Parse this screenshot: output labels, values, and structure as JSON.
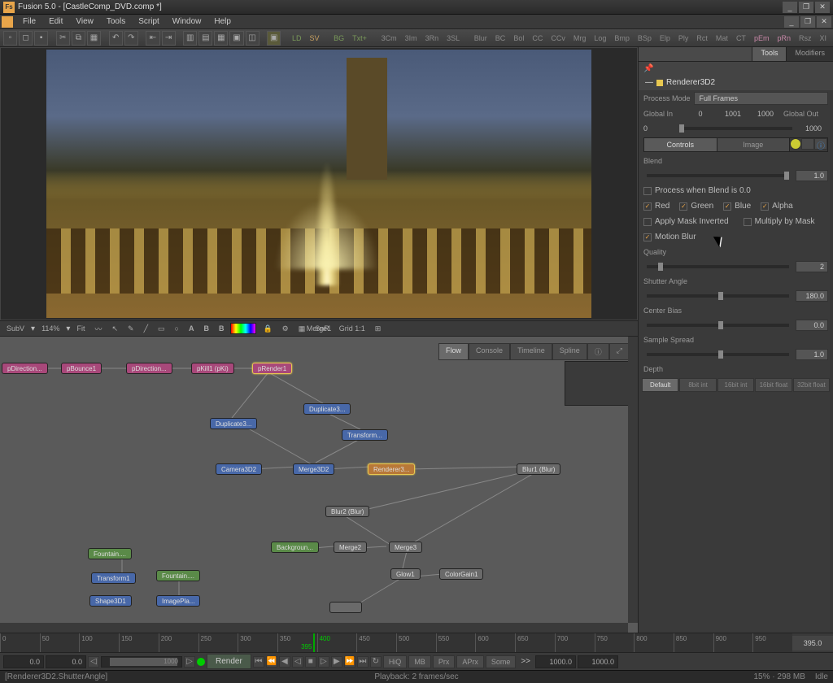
{
  "title": "Fusion 5.0 - [CastleComp_DVD.comp *]",
  "menu": [
    "File",
    "Edit",
    "View",
    "Tools",
    "Script",
    "Window",
    "Help"
  ],
  "toolbar_text": [
    "LD",
    "SV",
    "BG",
    "Txt+",
    "3Cm",
    "3Im",
    "3Rn",
    "3SL",
    "Blur",
    "BC",
    "Bol",
    "CC",
    "CCv",
    "Mrg",
    "Log",
    "Bmp",
    "BSp",
    "Elp",
    "Ply",
    "Rct",
    "Mat",
    "CT",
    "pEm",
    "pRn",
    "Rsz",
    "XI"
  ],
  "viewer_toolbar": {
    "subv": "SubV",
    "zoom": "114%",
    "fit": "Fit",
    "abb": [
      "A",
      "B",
      "B"
    ],
    "snr": "SnR",
    "grid": "Grid 1:1",
    "current": "Merge1"
  },
  "flow_tabs": [
    "Flow",
    "Console",
    "Timeline",
    "Spline"
  ],
  "nodes": {
    "pDirection1": "pDirection...",
    "pBounce1": "pBounce1",
    "pDirection2": "pDirection...",
    "pKill1": "pKill1  (pKi)",
    "pRender1": "pRender1",
    "Duplicate3a": "Duplicate3...",
    "Duplicate3b": "Duplicate3...",
    "Transform1": "Transform...",
    "Camera3D2": "Camera3D2",
    "Merge3D2": "Merge3D2",
    "Renderer3": "Renderer3...",
    "Blur1": "Blur1  (Blur)",
    "Blur2": "Blur2  (Blur)",
    "Background": "Backgroun...",
    "Merge2": "Merge2",
    "Merge3": "Merge3",
    "Fountain1": "Fountain....",
    "Fountain2": "Fountain....",
    "TransformB": "Transform1",
    "Shape3D1": "Shape3D1",
    "ImagePla": "ImagePla...",
    "Glow1": "Glow1",
    "ColorGain1": "ColorGain1",
    "Unnamed": ""
  },
  "inspector": {
    "name": "Renderer3D2",
    "process_mode_lbl": "Process Mode",
    "process_mode": "Full Frames",
    "global_in_lbl": "Global In",
    "global_out_lbl": "Global Out",
    "global_in": "0",
    "mid1": "1001",
    "mid2": "1000",
    "global_out": "1000",
    "global_low": "0",
    "tabs": [
      "Controls",
      "Image"
    ],
    "blend_lbl": "Blend",
    "blend_val": "1.0",
    "process_when": "Process when Blend is 0.0",
    "red": "Red",
    "green": "Green",
    "blue": "Blue",
    "alpha": "Alpha",
    "apply_mask": "Apply Mask Inverted",
    "multiply": "Multiply by Mask",
    "motion_blur": "Motion Blur",
    "quality_lbl": "Quality",
    "quality_val": "2",
    "shutter_lbl": "Shutter Angle",
    "shutter_val": "180.0",
    "center_lbl": "Center Bias",
    "center_val": "0.0",
    "spread_lbl": "Sample Spread",
    "spread_val": "1.0",
    "depth_lbl": "Depth",
    "depth_opts": [
      "Default",
      "8bit int",
      "16bit int",
      "16bit float",
      "32bit float"
    ]
  },
  "right_tabs": [
    "Tools",
    "Modifiers"
  ],
  "timeline": {
    "ticks": [
      "0",
      "50",
      "100",
      "150",
      "200",
      "250",
      "300",
      "350",
      "400",
      "450",
      "500",
      "550",
      "600",
      "650",
      "700",
      "750",
      "800",
      "850",
      "900",
      "950"
    ],
    "current": "395.0",
    "marker": "395"
  },
  "transport": {
    "start": "0.0",
    "in": "0.0",
    "range_end": "1000",
    "render": "Render",
    "hiq": "HiQ",
    "mb": "MB",
    "prx": "Prx",
    "aprx": "APrx",
    "some": "Some",
    "out": "1000.0",
    "end": "1000.0"
  },
  "status": {
    "left": "[Renderer3D2.ShutterAngle]",
    "mid": "Playback: 2 frames/sec",
    "right": "15%  ·  298 MB",
    "idle": "Idle"
  }
}
